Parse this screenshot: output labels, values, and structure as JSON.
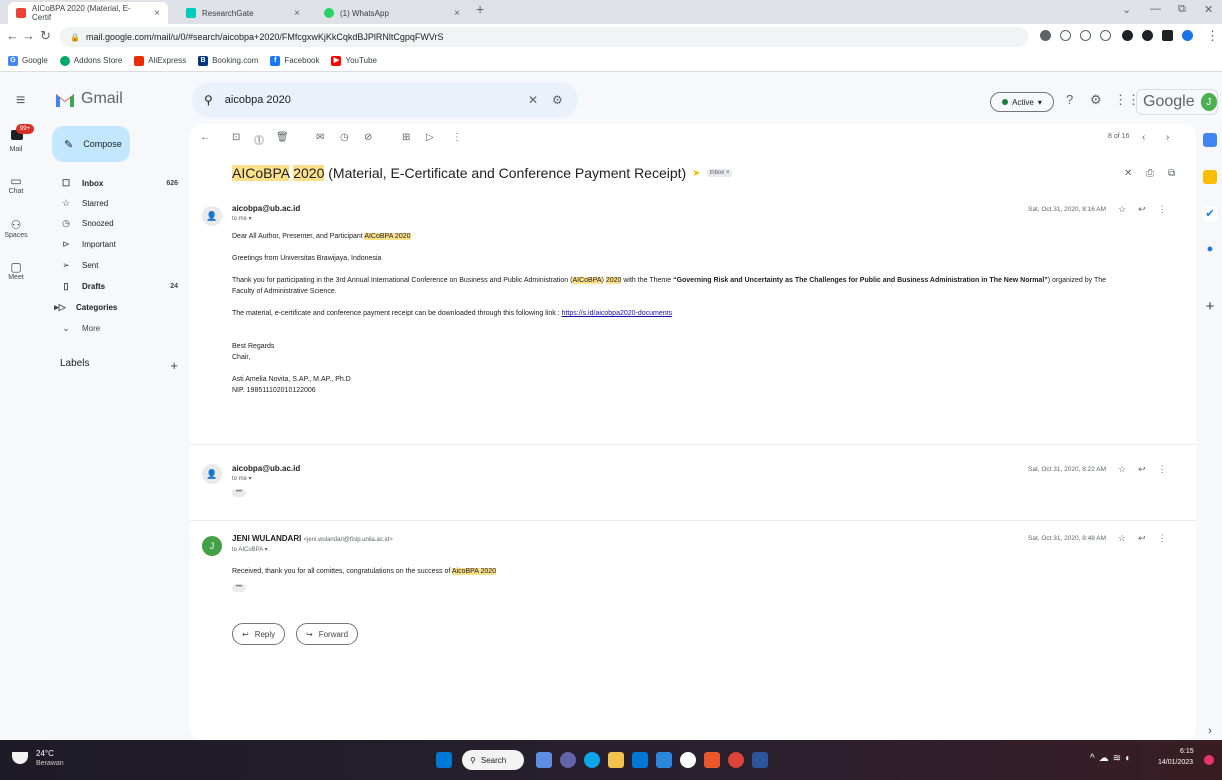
{
  "browser": {
    "tabs": [
      {
        "label": "AICoBPA 2020 (Material, E-Certif",
        "active": true
      },
      {
        "label": "ResearchGate",
        "active": false
      },
      {
        "label": "(1) WhatsApp",
        "active": false
      }
    ],
    "url": "mail.google.com/mail/u/0/#search/aicobpa+2020/FMfcgxwKjKkCqkdBJPlRNltCgpqFWVrS",
    "bookmarks": [
      "Google",
      "Addons Store",
      "AliExpress",
      "Booking.com",
      "Facebook",
      "YouTube"
    ]
  },
  "gmail": {
    "brand": "Gmail",
    "search_query": "aicobpa 2020",
    "status": "Active",
    "account_brand": "Google",
    "avatar_letter": "J"
  },
  "rail": {
    "mail_badge": "99+",
    "items": [
      "Mail",
      "Chat",
      "Spaces",
      "Meet"
    ]
  },
  "nav": {
    "compose": "Compose",
    "items": [
      {
        "label": "Inbox",
        "count": "626"
      },
      {
        "label": "Starred",
        "count": ""
      },
      {
        "label": "Snoozed",
        "count": ""
      },
      {
        "label": "Important",
        "count": ""
      },
      {
        "label": "Sent",
        "count": ""
      },
      {
        "label": "Drafts",
        "count": "24"
      },
      {
        "label": "Categories",
        "count": ""
      },
      {
        "label": "More",
        "count": ""
      }
    ],
    "labels_header": "Labels"
  },
  "thread": {
    "pager": "8 of 16",
    "subject_hl1": "AICoBPA",
    "subject_hl2": "2020",
    "subject_rest": "(Material, E-Certificate and Conference Payment Receipt)",
    "inbox_tag": "Inbox ×",
    "messages": [
      {
        "sender": "aicobpa@ub.ac.id",
        "to": "to me ▾",
        "date": "Sat, Oct 31, 2020, 8:16 AM",
        "lines": {
          "greet": "Dear All Author, Presenter, and Participant",
          "greet_hl": "AICoBPA 2020",
          "from": "Greetings from Universitas Brawijaya, Indonesia",
          "thanks_a": "Thank you for participating in the 3rd Annual International Conference on Business and Public Administration (",
          "thanks_hl1": "AICoBPA",
          "thanks_b": ")",
          "thanks_hl2": "2020",
          "thanks_c": "with the Theme",
          "thanks_bold": "“Governing Risk and Uncertainty as The Challenges for Public and Business Administration in The New Normal”",
          "thanks_d": ") organized by The",
          "thanks_e": "Faculty of Administrative Science.",
          "link_intro": "The material, e-certificate and conference payment receipt can be downloaded through this following link :",
          "link": "https://s.id/aicobpa2020-documents",
          "regards": "Best Regards",
          "chair": "Chair,",
          "name": "Asti Amelia Novita, S.AP., M.AP., Ph.D",
          "nip": "NIP. 198511102010122006"
        }
      },
      {
        "sender": "aicobpa@ub.ac.id",
        "to": "to me ▾",
        "date": "Sat, Oct 31, 2020, 8:22 AM"
      },
      {
        "sender": "JENI WULANDARI",
        "email": "<jeni.wulandari@fisip.unila.ac.id>",
        "to": "to AICoBPA ▾",
        "date": "Sat, Oct 31, 2020, 8:48 AM",
        "body": "Received, thank you for all comittes, congratulations on the success of",
        "body_hl": "AicoBPA 2020",
        "avatar": "J"
      }
    ],
    "reply": "Reply",
    "forward": "Forward"
  },
  "taskbar": {
    "temp": "24°C",
    "weather": "Berawan",
    "search": "Search",
    "time": "6:15",
    "date": "14/01/2023"
  }
}
